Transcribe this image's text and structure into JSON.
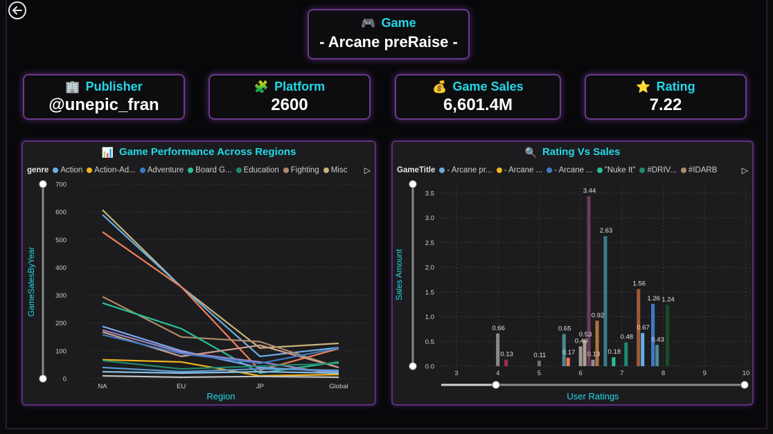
{
  "header": {
    "game_label": "Game",
    "game_name": "- Arcane preRaise -"
  },
  "kpis": [
    {
      "label": "Publisher",
      "value": "@unepic_fran",
      "icon": "office-building-icon"
    },
    {
      "label": "Platform",
      "value": "2600",
      "icon": "puzzle-piece-icon"
    },
    {
      "label": "Game Sales",
      "value": "6,601.4M",
      "icon": "money-bag-icon"
    },
    {
      "label": "Rating",
      "value": "7.22",
      "icon": "star-icon"
    }
  ],
  "colors": {
    "accent": "#22d8e6",
    "border": "#6a3a8c",
    "panel_bg": "#1c1c1e"
  },
  "left_chart": {
    "title": "Game Performance Across Regions",
    "legend_title": "genre",
    "legend": [
      {
        "name": "Action",
        "color": "#6aaee6"
      },
      {
        "name": "Action-Ad...",
        "color": "#f2b41c"
      },
      {
        "name": "Adventure",
        "color": "#3f7ac4"
      },
      {
        "name": "Board G...",
        "color": "#2bbf96"
      },
      {
        "name": "Education",
        "color": "#1f8a6d"
      },
      {
        "name": "Fighting",
        "color": "#b08a6a"
      },
      {
        "name": "Misc",
        "color": "#c8b47a"
      }
    ]
  },
  "right_chart": {
    "title": "Rating Vs Sales",
    "legend_title": "GameTitle",
    "legend": [
      {
        "name": "- Arcane pr...",
        "color": "#6aaee6"
      },
      {
        "name": "- Arcane ...",
        "color": "#f2b41c"
      },
      {
        "name": "- Arcane ...",
        "color": "#3f7ac4"
      },
      {
        "name": "\"Nuke It\"",
        "color": "#2bbf96"
      },
      {
        "name": "#DRIV...",
        "color": "#1f8a6d"
      },
      {
        "name": "#IDARB",
        "color": "#b08a6a"
      }
    ]
  },
  "chart_data": [
    {
      "type": "line",
      "title": "Game Performance Across Regions",
      "xlabel": "Region",
      "ylabel": "GameSalesByYear",
      "categories": [
        "NA",
        "EU",
        "JP",
        "Global"
      ],
      "ylim": [
        0,
        700
      ],
      "yticks": [
        0,
        100,
        200,
        300,
        400,
        500,
        600,
        700
      ],
      "grid": true,
      "series": [
        {
          "color": "#c8b47a",
          "values": [
            607,
            330,
            110,
            127
          ]
        },
        {
          "color": "#6aaee6",
          "values": [
            590,
            330,
            80,
            112
          ]
        },
        {
          "color": "#f0805a",
          "values": [
            528,
            330,
            30,
            108
          ]
        },
        {
          "color": "#b08a6a",
          "values": [
            295,
            150,
            133,
            40
          ]
        },
        {
          "color": "#2bbf96",
          "values": [
            272,
            180,
            20,
            60
          ]
        },
        {
          "color": "#7fa6f0",
          "values": [
            188,
            100,
            40,
            25
          ]
        },
        {
          "color": "#9a88c8",
          "values": [
            175,
            95,
            60,
            15
          ]
        },
        {
          "color": "#d0a090",
          "values": [
            168,
            80,
            120,
            40
          ]
        },
        {
          "color": "#3f7ac4",
          "values": [
            158,
            90,
            55,
            110
          ]
        },
        {
          "color": "#f2b41c",
          "values": [
            68,
            60,
            10,
            15
          ]
        },
        {
          "color": "#1f8a6d",
          "values": [
            65,
            35,
            45,
            55
          ]
        },
        {
          "color": "#5a9ad0",
          "values": [
            40,
            25,
            35,
            30
          ]
        },
        {
          "color": "#8abfdf",
          "values": [
            25,
            20,
            25,
            20
          ]
        },
        {
          "color": "#c0c0c0",
          "values": [
            10,
            5,
            8,
            5
          ]
        }
      ]
    },
    {
      "type": "bar",
      "title": "Rating Vs Sales",
      "xlabel": "User Ratings",
      "ylabel": "Sales Amount",
      "xlim": [
        3,
        10
      ],
      "ylim": [
        0,
        3.5
      ],
      "xticks": [
        3,
        4,
        5,
        6,
        7,
        8,
        9,
        10
      ],
      "yticks": [
        0.0,
        0.5,
        1.0,
        1.5,
        2.0,
        2.5,
        3.0,
        3.5
      ],
      "grid": true,
      "bars": [
        {
          "x": 4.0,
          "value": 0.66,
          "label": "0.66",
          "color": "#8a8a8a"
        },
        {
          "x": 4.2,
          "value": 0.13,
          "label": "0.13",
          "color": "#a03040"
        },
        {
          "x": 5.0,
          "value": 0.11,
          "label": "0.11",
          "color": "#707070"
        },
        {
          "x": 5.6,
          "value": 0.65,
          "label": "0.65",
          "color": "#4a8a90"
        },
        {
          "x": 5.7,
          "value": 0.17,
          "label": "0.17",
          "color": "#f07a5a"
        },
        {
          "x": 6.0,
          "value": 0.4,
          "label": "0.40",
          "color": "#9a9a9a"
        },
        {
          "x": 6.1,
          "value": 0.53,
          "label": "0.53",
          "color": "#b0a08a"
        },
        {
          "x": 6.2,
          "value": 3.44,
          "label": "3.44",
          "color": "#6a3a5a"
        },
        {
          "x": 6.3,
          "value": 0.13,
          "label": "0.13",
          "color": "#8f8f9f"
        },
        {
          "x": 6.4,
          "value": 0.92,
          "label": "0.92",
          "color": "#b0743a"
        },
        {
          "x": 6.6,
          "value": 2.63,
          "label": "2.63",
          "color": "#3a7a8a"
        },
        {
          "x": 6.8,
          "value": 0.18,
          "label": "0.18",
          "color": "#2bbf96"
        },
        {
          "x": 7.1,
          "value": 0.48,
          "label": "0.48",
          "color": "#1f8a6d"
        },
        {
          "x": 7.4,
          "value": 1.56,
          "label": "1.56",
          "color": "#a05a3a"
        },
        {
          "x": 7.5,
          "value": 0.67,
          "label": "0.67",
          "color": "#6aaee6"
        },
        {
          "x": 7.75,
          "value": 1.26,
          "label": "1.26",
          "color": "#3f7ac4"
        },
        {
          "x": 7.85,
          "value": 0.43,
          "label": "0.43",
          "color": "#4a8a90"
        },
        {
          "x": 8.1,
          "value": 1.24,
          "label": "1.24",
          "color": "#1a4a2a"
        }
      ]
    }
  ]
}
